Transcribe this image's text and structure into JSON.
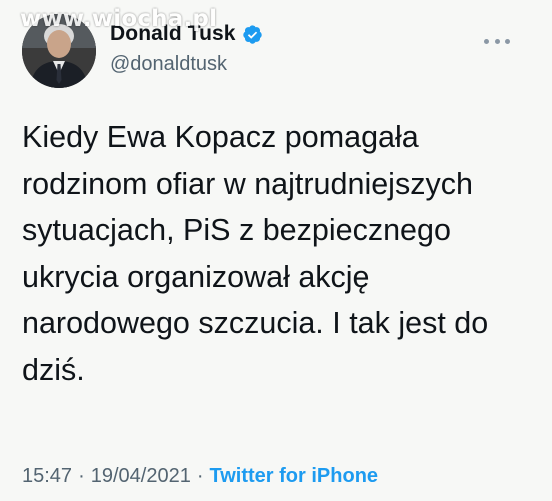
{
  "watermark": "www.wiocha.pl",
  "author": {
    "display_name": "Donald Tusk",
    "handle": "@donaldtusk",
    "verified": true,
    "verified_badge_color": "#1d9bf0"
  },
  "tweet": {
    "text": "Kiedy Ewa Kopacz pomagała\nrodzinom ofiar w najtrudniejszych\nsytuacjach, PiS z bezpiecznego\nukrycia organizował akcję\nnarodowego szczucia. I tak jest do\ndziś.",
    "time": "15:47",
    "date": "19/04/2021",
    "separator": "·",
    "source": "Twitter for iPhone"
  },
  "icons": {
    "more": "more-horizontal-icon",
    "verified": "verified-badge-icon"
  },
  "colors": {
    "background": "#f7f8f6",
    "text": "#0f1419",
    "secondary_text": "#536471",
    "link": "#1d9bf0"
  }
}
